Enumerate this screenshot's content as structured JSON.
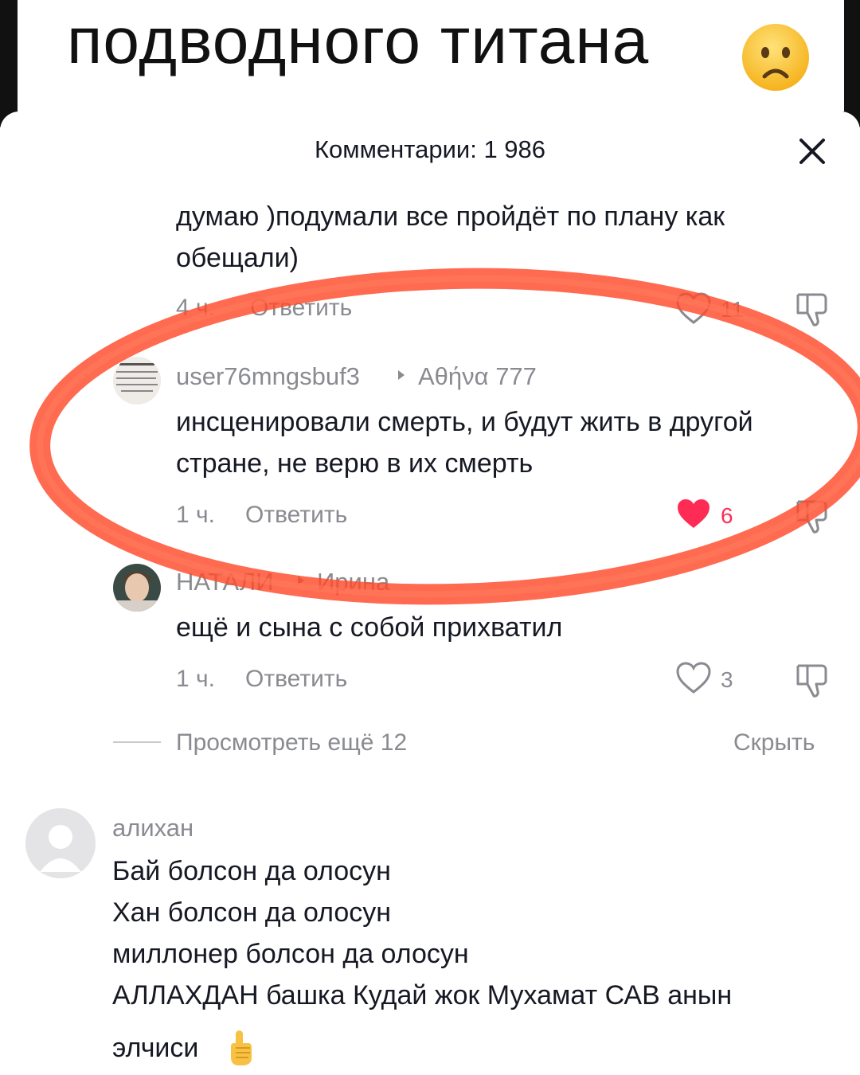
{
  "video_caption": {
    "text": "подводного титана",
    "emoji": "worried-face-emoji"
  },
  "sheet": {
    "title": "Комментарии: 1 986",
    "close_icon": "close-icon"
  },
  "comments": [
    {
      "text_lines": [
        "думаю )подумали все пройдёт по плану как",
        "обещали)"
      ],
      "time": "4 ч.",
      "reply_label": "Ответить",
      "likes": "11",
      "liked": false
    },
    {
      "username": "user76mngsbuf3",
      "reply_to": "Αθήνα 777",
      "text_lines": [
        "инсценировали смерть, и будут жить в другой",
        "стране, не верю в их смерть"
      ],
      "time": "1 ч.",
      "reply_label": "Ответить",
      "likes": "6",
      "liked": true
    },
    {
      "username": "НАТАЛИ",
      "reply_to": "Ирина",
      "text_lines": [
        "ещё и сына с собой прихватил"
      ],
      "time": "1 ч.",
      "reply_label": "Ответить",
      "likes": "3",
      "liked": false
    }
  ],
  "view_more": {
    "label": "Просмотреть ещё 12",
    "hide_label": "Скрыть"
  },
  "main_comment": {
    "username": "алихан",
    "text_lines": [
      "Бай болсон да олосун",
      "Хан болсон да олосун",
      "миллонер болсон да олосун",
      "АЛЛАХДАН башка Кудай жок Мухамат САВ анын",
      "элчиси"
    ],
    "emoji": "pointing-up-emoji"
  },
  "colors": {
    "like_red": "#FE2C55",
    "annotation_ring": "#FF4A2A",
    "muted": "#8A8B91"
  }
}
